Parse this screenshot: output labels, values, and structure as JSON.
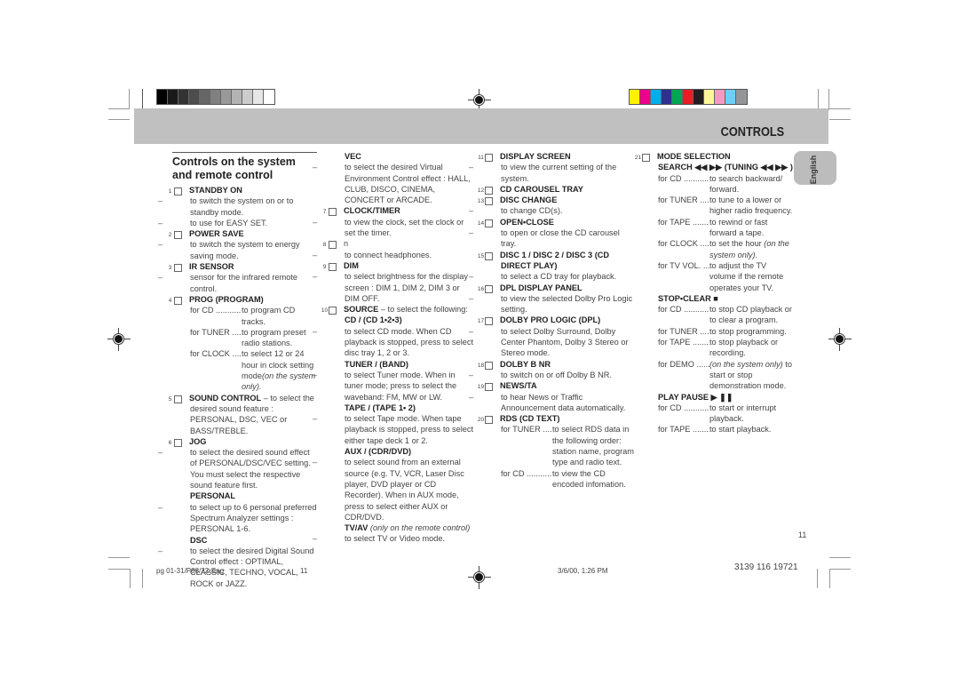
{
  "header": {
    "title": "CONTROLS",
    "language_tab": "English"
  },
  "color_bar": {
    "grays": [
      "#000000",
      "#1a1a1a",
      "#333333",
      "#4d4d4d",
      "#666666",
      "#808080",
      "#999999",
      "#b3b3b3",
      "#cccccc",
      "#e6e6e6",
      "#ffffff"
    ],
    "colors": [
      "#fff200",
      "#ec008c",
      "#00aeef",
      "#2e3192",
      "#00a651",
      "#ed1c24",
      "#231f20",
      "#fff799",
      "#f49ac1",
      "#6dcff6",
      "#939598"
    ]
  },
  "section": {
    "title": "Controls on the system and remote control"
  },
  "col1": [
    {
      "type": "item",
      "num": "1",
      "label": "STANDBY ON"
    },
    {
      "type": "dash",
      "text": "to switch the system on or to standby mode."
    },
    {
      "type": "dash",
      "text": "to use for EASY SET."
    },
    {
      "type": "item",
      "num": "2",
      "label": "POWER SAVE"
    },
    {
      "type": "dash",
      "text": "to switch the system to energy saving mode."
    },
    {
      "type": "item",
      "num": "3",
      "label": "IR SENSOR"
    },
    {
      "type": "dash",
      "text": "sensor for the infrared remote control."
    },
    {
      "type": "item",
      "num": "4",
      "label": "PROG (PROGRAM)"
    },
    {
      "type": "def",
      "key": "for CD ............",
      "val": "to program CD tracks."
    },
    {
      "type": "def",
      "key": "for TUNER .....",
      "val": "to program preset radio stations."
    },
    {
      "type": "def",
      "key": "for CLOCK .....",
      "val": "to select 12 or 24 hour in clock setting mode",
      "note": "(on the system only)."
    },
    {
      "type": "item",
      "num": "5",
      "label": "SOUND CONTROL",
      "suffix": " – to select the desired sound feature : PERSONAL, DSC, VEC or BASS/TREBLE."
    },
    {
      "type": "item",
      "num": "6",
      "label": "JOG"
    },
    {
      "type": "dash",
      "text": "to select the desired sound effect of PERSONAL/DSC/VEC setting.  You must select the respective sound feature first."
    },
    {
      "type": "sub",
      "label": "PERSONAL"
    },
    {
      "type": "dash",
      "text": "to select up to 6 personal preferred Spectrum Analyzer settings : PERSONAL 1-6."
    },
    {
      "type": "sub",
      "label": "DSC"
    },
    {
      "type": "dash",
      "text": "to select the desired Digital Sound Control effect : OPTIMAL, CLASSIC, TECHNO, VOCAL, ROCK or JAZZ."
    }
  ],
  "col2": [
    {
      "type": "sub",
      "label": "VEC"
    },
    {
      "type": "dash",
      "text": "to select the desired Virtual Environment Control effect : HALL, CLUB, DISCO, CINEMA, CONCERT or ARCADE."
    },
    {
      "type": "item",
      "num": "7",
      "label": "CLOCK/TIMER"
    },
    {
      "type": "dash",
      "text": "to view the clock, set the clock or set the timer."
    },
    {
      "type": "item",
      "num": "8",
      "label": "n",
      "plain": true
    },
    {
      "type": "dash",
      "text": "to connect headphones."
    },
    {
      "type": "item",
      "num": "9",
      "label": "DIM"
    },
    {
      "type": "dash",
      "text": "to select brightness for the display screen : DIM 1, DIM 2, DIM 3 or DIM OFF."
    },
    {
      "type": "item",
      "num": "10",
      "label": "SOURCE",
      "suffix": " – to select the following:"
    },
    {
      "type": "sub",
      "label": "CD / (CD 1•2•3)"
    },
    {
      "type": "dash",
      "text": "to select CD mode. When CD playback is stopped, press to select disc tray 1, 2 or 3."
    },
    {
      "type": "sub",
      "label": "TUNER / (BAND)"
    },
    {
      "type": "dash",
      "text": "to select Tuner mode. When in tuner mode; press to select the waveband: FM, MW or LW."
    },
    {
      "type": "sub",
      "label": "TAPE / (TAPE 1• 2)"
    },
    {
      "type": "dash",
      "text": "to select Tape mode. When tape playback is stopped, press to select either tape deck 1 or 2."
    },
    {
      "type": "sub",
      "label": "AUX / (CDR/DVD)"
    },
    {
      "type": "dash",
      "text": "to select sound from an external source (e.g. TV, VCR, Laser Disc player, DVD player or CD Recorder). When in AUX mode, press to select either AUX or CDR/DVD."
    },
    {
      "type": "sub",
      "label": "TV/AV",
      "note": " (only on the remote control)"
    },
    {
      "type": "dash",
      "text": "to select TV or Video mode."
    }
  ],
  "col3": [
    {
      "type": "item",
      "num": "11",
      "label": "DISPLAY SCREEN"
    },
    {
      "type": "dash",
      "text": "to view the current setting of the system."
    },
    {
      "type": "item",
      "num": "12",
      "label": "CD CAROUSEL TRAY"
    },
    {
      "type": "item",
      "num": "13",
      "label": "DISC CHANGE"
    },
    {
      "type": "dash",
      "text": "to change CD(s)."
    },
    {
      "type": "item",
      "num": "14",
      "label": "OPEN•CLOSE"
    },
    {
      "type": "dash",
      "text": "to open or close the CD carousel tray."
    },
    {
      "type": "item",
      "num": "15",
      "label": "DISC 1 / DISC 2 / DISC 3 (CD DIRECT PLAY)"
    },
    {
      "type": "dash",
      "text": "to select a CD tray for playback."
    },
    {
      "type": "item",
      "num": "16",
      "label": "DPL DISPLAY PANEL"
    },
    {
      "type": "dash",
      "text": "to view the selected Dolby Pro Logic setting."
    },
    {
      "type": "item",
      "num": "17",
      "label": "DOLBY PRO LOGIC (DPL)"
    },
    {
      "type": "dash",
      "text": "to select Dolby Surround, Dolby Center Phantom, Dolby 3 Stereo or Stereo mode."
    },
    {
      "type": "item",
      "num": "18",
      "label": "DOLBY B NR"
    },
    {
      "type": "dash",
      "text": "to switch on or off Dolby B NR."
    },
    {
      "type": "item",
      "num": "19",
      "label": "NEWS/TA"
    },
    {
      "type": "dash",
      "text": "to hear News or Traffic Announcement data automatically."
    },
    {
      "type": "item",
      "num": "20",
      "label": "RDS (CD TEXT)"
    },
    {
      "type": "def",
      "key": "for TUNER .....",
      "val": "to select RDS data in the following order: station name, program type and radio text."
    },
    {
      "type": "def",
      "key": "for CD ............",
      "val": "to view the CD encoded infomation."
    }
  ],
  "col4": [
    {
      "type": "item",
      "num": "21",
      "label": "MODE SELECTION"
    },
    {
      "type": "sub",
      "label": "SEARCH ◀◀ ▶▶ (TUNING ◀◀ ▶▶ )"
    },
    {
      "type": "def",
      "key": "for CD ............",
      "val": "to search backward/ forward."
    },
    {
      "type": "def",
      "key": "for TUNER .....",
      "val": "to tune to a lower or higher radio frequency."
    },
    {
      "type": "def",
      "key": "for TAPE ........",
      "val": "to rewind or fast forward a tape."
    },
    {
      "type": "def",
      "key": "for CLOCK .....",
      "val": "to set the hour",
      "note": " (on the system only)."
    },
    {
      "type": "def",
      "key": "for TV VOL. ....",
      "val": "to adjust the TV volume if the remote operates your TV."
    },
    {
      "type": "sub",
      "label": "STOP•CLEAR ■"
    },
    {
      "type": "def",
      "key": "for CD ............",
      "val": "to stop CD playback or to clear a program."
    },
    {
      "type": "def",
      "key": "for TUNER .....",
      "val": "to stop programming."
    },
    {
      "type": "def",
      "key": "for TAPE ........",
      "val": "to stop playback or recording."
    },
    {
      "type": "def",
      "key": "for DEMO ......",
      "note_first": "(on the system only)",
      "val": " to start or stop demonstration mode."
    },
    {
      "type": "sub",
      "label": "PLAY  PAUSE ▶ ❚❚"
    },
    {
      "type": "def",
      "key": "for CD ............",
      "val": "to start or interrupt playback."
    },
    {
      "type": "def",
      "key": "for TAPE ........",
      "val": "to start playback."
    }
  ],
  "page_number": "11",
  "footer": {
    "file": "pg 01-31/P88/22-Eng",
    "page": "11",
    "datetime": "3/6/00, 1:26 PM",
    "code": "3139 116 19721"
  }
}
